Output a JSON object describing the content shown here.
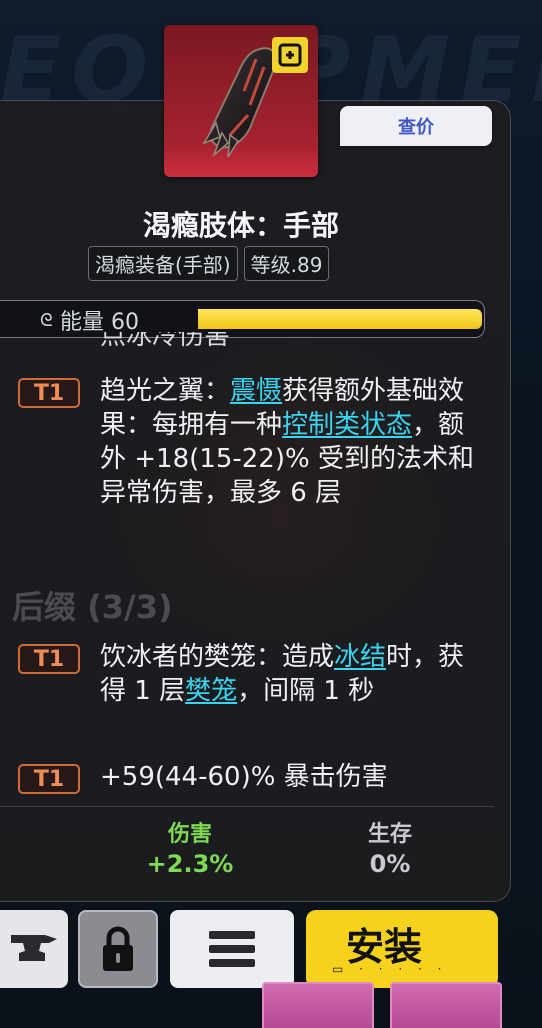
{
  "item": {
    "name": "渴瘾肢体：手部",
    "tags": [
      "渴瘾装备(手部)",
      "等级.89"
    ],
    "price_button": "查价",
    "equip_badge_icon": "equipped-badge-icon",
    "icon": "gauntlet-icon"
  },
  "energy": {
    "label": "能量 60",
    "value": 60,
    "fill_fraction": 1.0
  },
  "prefix_tail": "点冰冷伤害",
  "affixes": [
    {
      "tier": "T1",
      "parts": [
        {
          "t": "趋光之翼："
        },
        {
          "t": "震慑",
          "kw": true
        },
        {
          "t": "获得额外基础效果：每拥有一种"
        },
        {
          "t": "控制类状态",
          "kw": true
        },
        {
          "t": "，额外 +18(15-22)% 受到的法术和异常伤害，最多 6 层"
        }
      ]
    }
  ],
  "suffix_section": {
    "title": "后缀 (3/3)"
  },
  "suffixes": [
    {
      "tier": "T1",
      "parts": [
        {
          "t": "饮冰者的樊笼：造成"
        },
        {
          "t": "冰结",
          "kw": true
        },
        {
          "t": "时，获得 1 层"
        },
        {
          "t": "樊笼",
          "kw": true
        },
        {
          "t": "，间隔 1 秒"
        }
      ]
    },
    {
      "tier": "T1",
      "parts": [
        {
          "t": "+59(44-60)% 暴击伤害"
        }
      ]
    }
  ],
  "stats": [
    {
      "label": "伤害",
      "value": "+2.3%",
      "color": "#7ed957"
    },
    {
      "label": "生存",
      "value": "0%",
      "color": "#c9cbd0"
    }
  ],
  "buttons": {
    "anvil_icon": "anvil-icon",
    "lock_icon": "lock-icon",
    "menu_icon": "menu-icon",
    "install_label": "安装"
  },
  "colors": {
    "keyword": "#3ad4f0",
    "tier": "#f08c58",
    "accent_yellow": "#f6d21c",
    "rarity_red": "#b32534"
  }
}
